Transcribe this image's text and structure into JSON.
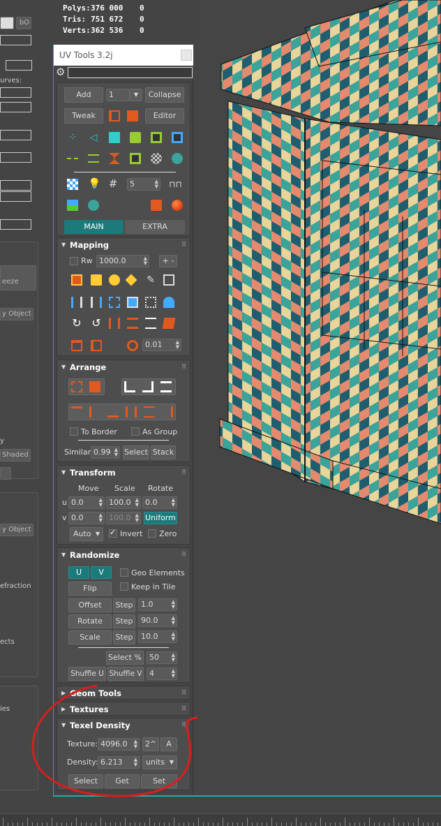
{
  "stats": {
    "rows": [
      {
        "label": "Polys:",
        "value": "376 000",
        "extra": "0"
      },
      {
        "label": "Tris:",
        "value": "751 672",
        "extra": "0"
      },
      {
        "label": "Verts:",
        "value": "362 536",
        "extra": "0"
      }
    ]
  },
  "left_panel": {
    "bo": "bO",
    "curves": "urves:",
    "freeze": "eeze",
    "by_object_1": "y Object",
    "y": "y",
    "shaded": "Shaded",
    "by_object_2": "y Object",
    "refraction": "efraction",
    "ects": "ects",
    "ies": "ies"
  },
  "uv_tools": {
    "title": "UV Tools 3.2j",
    "add": "Add",
    "channel": "1",
    "collapse": "Collapse",
    "tweak": "Tweak",
    "editor": "Editor",
    "grid_count": "5",
    "tab_main": "MAIN",
    "tab_extra": "EXTRA",
    "accent": "#1b7a7a",
    "mapping": {
      "title": "Mapping",
      "rw": "Rw",
      "rw_value": "1000.0",
      "plus_minus": "+ -",
      "spin_value": "0.01"
    },
    "arrange": {
      "title": "Arrange",
      "to_border": "To Border",
      "as_group": "As Group",
      "similar_label": "Similar:",
      "similar_value": "0.99",
      "select": "Select",
      "stack": "Stack"
    },
    "transform": {
      "title": "Transform",
      "move": "Move",
      "scale": "Scale",
      "rotate": "Rotate",
      "u": "u",
      "v": "v",
      "u_move": "0.0",
      "u_scale": "100.0",
      "u_rotate": "0.0",
      "v_move": "0.0",
      "v_scale": "100.0",
      "uniform": "Uniform",
      "auto": "Auto",
      "invert": "Invert",
      "zero": "Zero"
    },
    "randomize": {
      "title": "Randomize",
      "u": "U",
      "v": "V",
      "geo_elements": "Geo Elements",
      "flip": "Flip",
      "keep_in_tile": "Keep in Tile",
      "offset": "Offset",
      "rotate": "Rotate",
      "scale": "Scale",
      "step": "Step",
      "offset_val": "1.0",
      "rotate_val": "90.0",
      "scale_val": "10.0",
      "select_pct": "Select %",
      "select_pct_val": "50",
      "shuffle_u": "Shuffle U",
      "shuffle_v": "Shuffle V",
      "shuffle_val": "4"
    },
    "geom_tools": {
      "title": "Geom Tools"
    },
    "textures": {
      "title": "Textures"
    },
    "texel_density": {
      "title": "Texel Density",
      "texture_label": "Texture:",
      "texture_value": "4096.0",
      "pow2": "2^",
      "a": "A",
      "density_label": "Density:",
      "density_value": "6.213",
      "units": "units",
      "select": "Select",
      "get": "Get",
      "set": "Set"
    }
  },
  "colors": {
    "teal": "#2a8080",
    "orange": "#e05a20",
    "checker_a": "#e58a6e",
    "checker_b": "#1f5e6e",
    "checker_c": "#3aa39a",
    "checker_d": "#e9d49a",
    "annotation": "#d81e1e"
  }
}
